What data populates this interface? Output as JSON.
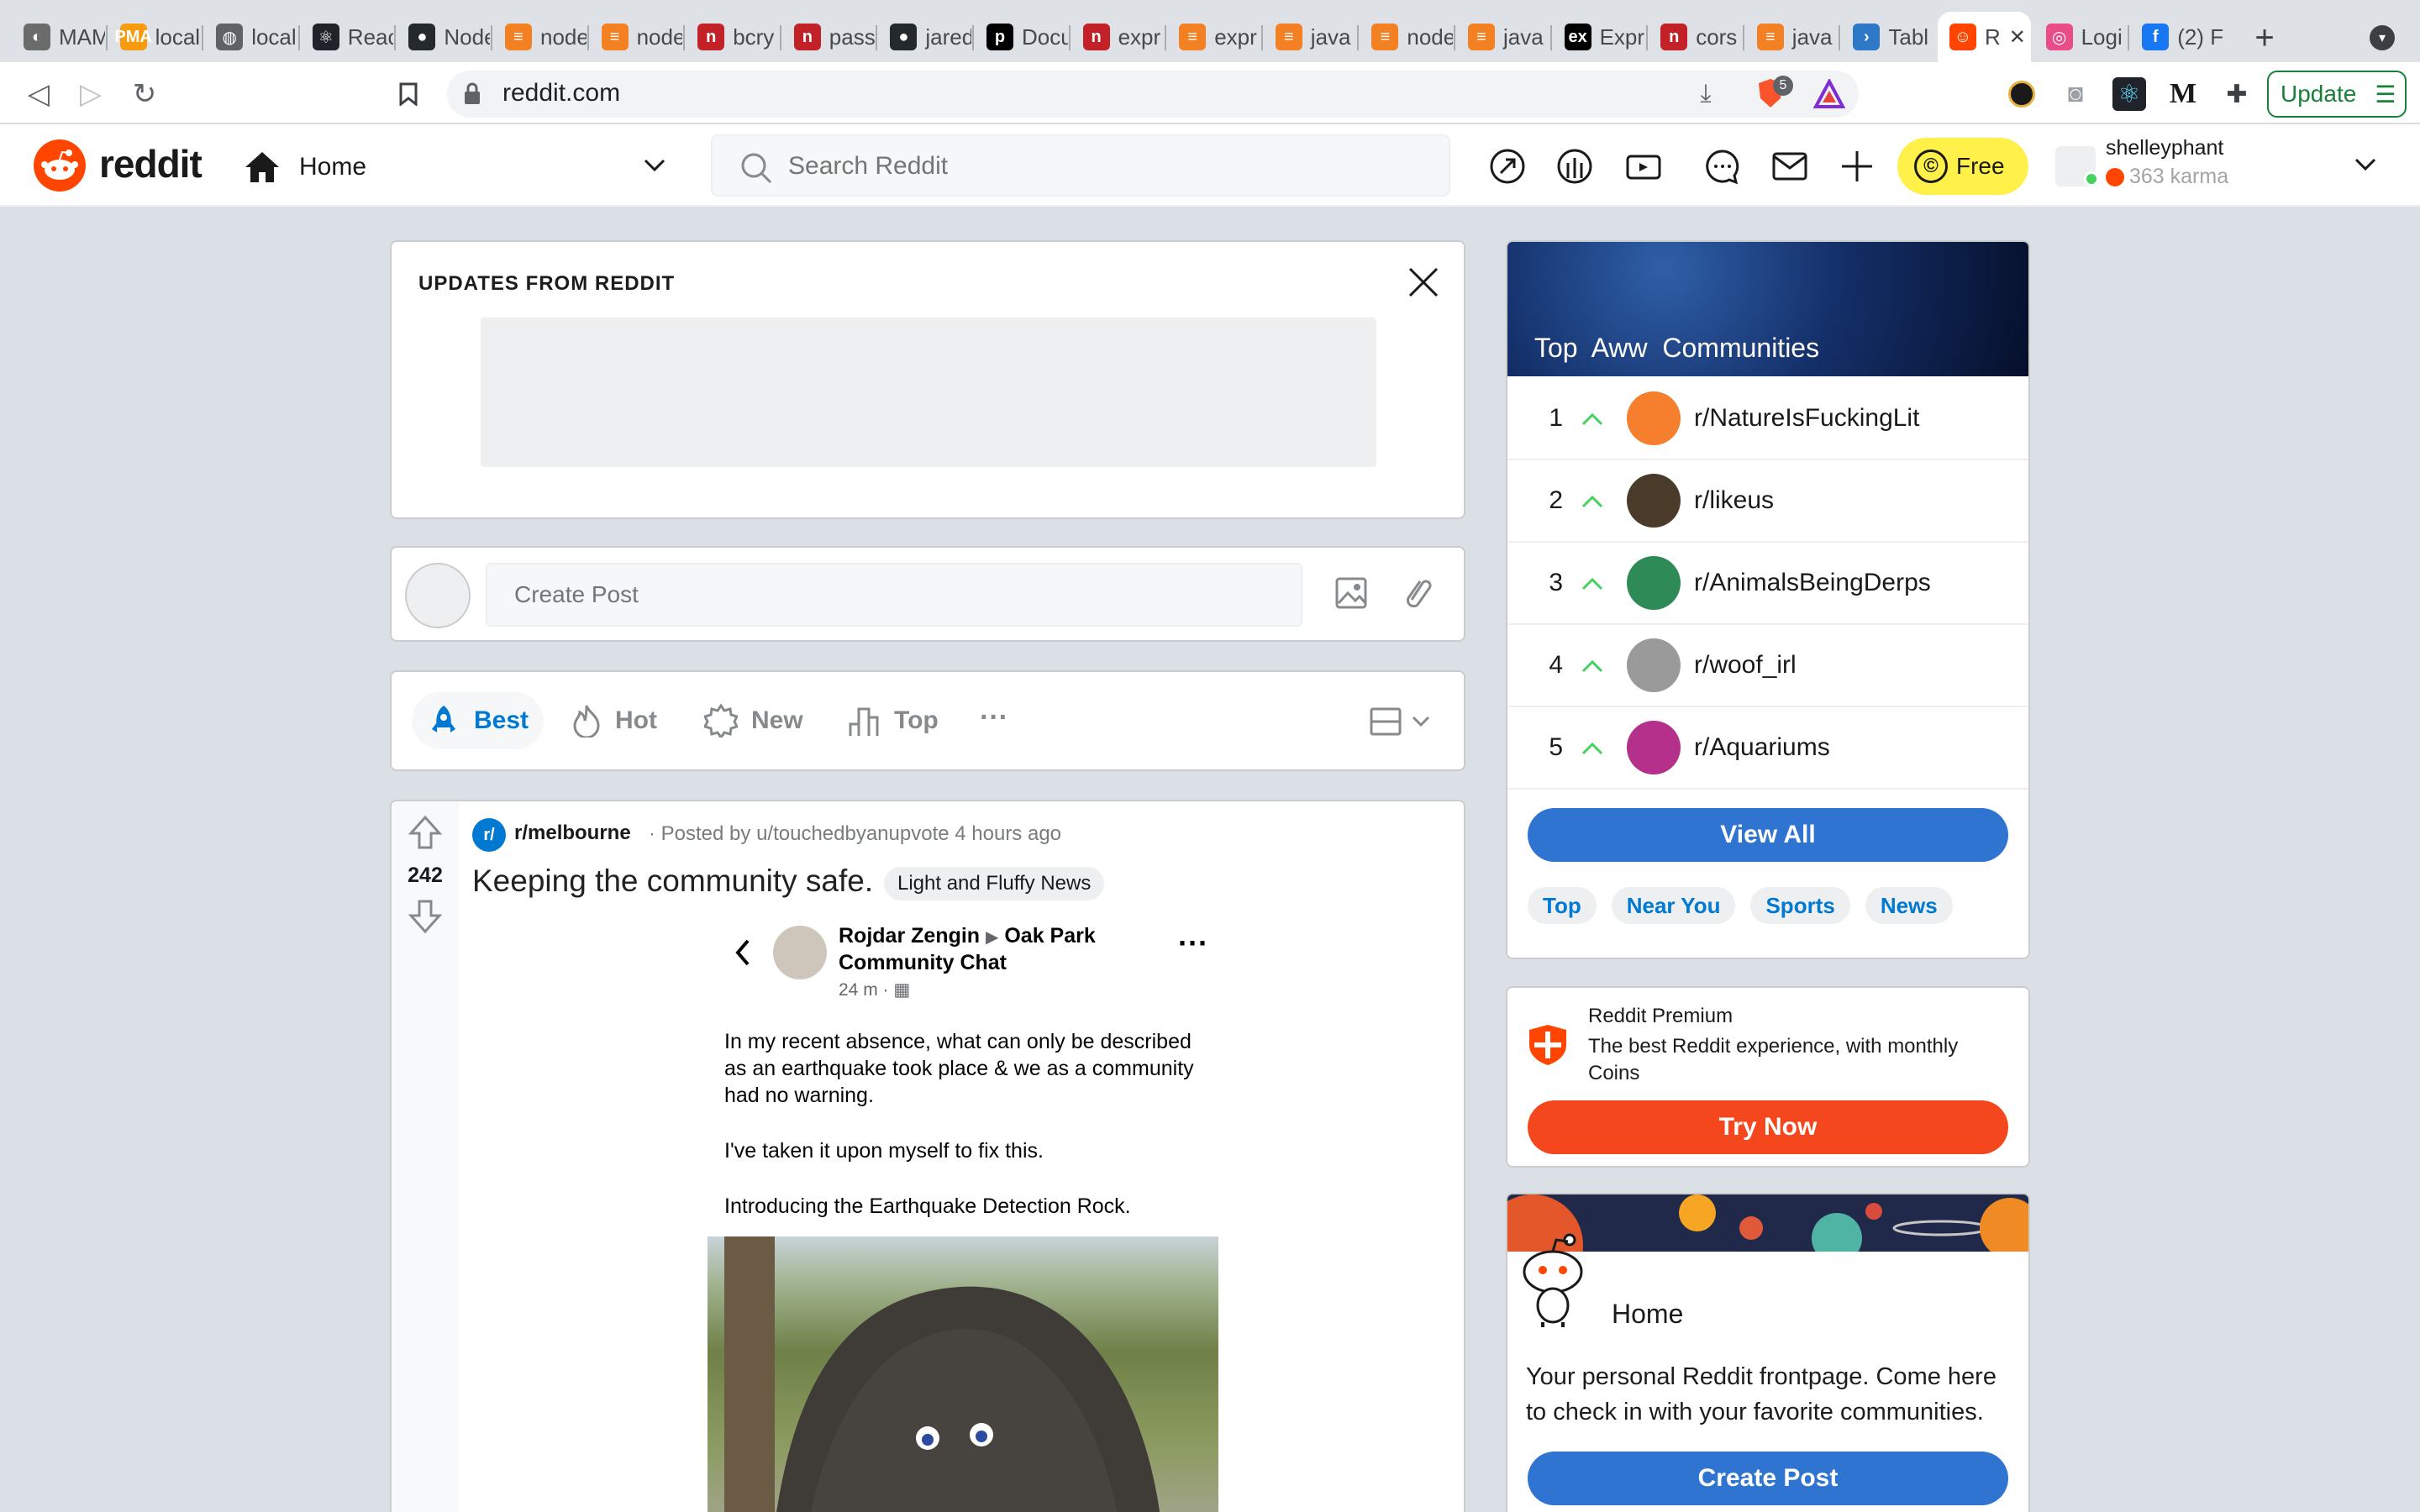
{
  "browser": {
    "tabs": [
      {
        "label": "MAM",
        "color": "#6b6b6b",
        "glyph": "◐"
      },
      {
        "label": "local",
        "color": "#f89c0e",
        "glyph": "PMA"
      },
      {
        "label": "local",
        "color": "#5f6368",
        "glyph": "◍"
      },
      {
        "label": "Reac",
        "color": "#20232a",
        "glyph": "⚛"
      },
      {
        "label": "Node",
        "color": "#24292e",
        "glyph": "●"
      },
      {
        "label": "node",
        "color": "#f48024",
        "glyph": "≡"
      },
      {
        "label": "node",
        "color": "#f48024",
        "glyph": "≡"
      },
      {
        "label": "bcry",
        "color": "#c12127",
        "glyph": "n"
      },
      {
        "label": "pass",
        "color": "#c12127",
        "glyph": "n"
      },
      {
        "label": "jared",
        "color": "#24292e",
        "glyph": "●"
      },
      {
        "label": "Docu",
        "color": "#000000",
        "glyph": "p"
      },
      {
        "label": "expr",
        "color": "#c12127",
        "glyph": "n"
      },
      {
        "label": "expr",
        "color": "#f48024",
        "glyph": "≡"
      },
      {
        "label": "java",
        "color": "#f48024",
        "glyph": "≡"
      },
      {
        "label": "node",
        "color": "#f48024",
        "glyph": "≡"
      },
      {
        "label": "java",
        "color": "#f48024",
        "glyph": "≡"
      },
      {
        "label": "Expr",
        "color": "#000000",
        "glyph": "ex"
      },
      {
        "label": "cors",
        "color": "#c12127",
        "glyph": "n"
      },
      {
        "label": "java",
        "color": "#f48024",
        "glyph": "≡"
      },
      {
        "label": "Tabl",
        "color": "#2d79c7",
        "glyph": "›"
      },
      {
        "label": "R",
        "color": "#ff4500",
        "glyph": "☺",
        "active": true
      },
      {
        "label": "Logi",
        "color": "#ea4c89",
        "glyph": "◎"
      },
      {
        "label": "(2) F",
        "color": "#1877f2",
        "glyph": "f"
      }
    ],
    "url": "reddit.com",
    "update_label": "Update",
    "brave_badge": "5"
  },
  "header": {
    "logo_text": "reddit",
    "home_label": "Home",
    "search_placeholder": "Search Reddit",
    "free_label": "Free",
    "username": "shelleyphant",
    "karma": "363 karma"
  },
  "updates": {
    "title": "UPDATES FROM REDDIT"
  },
  "create_post": {
    "placeholder": "Create Post"
  },
  "sort": {
    "best": "Best",
    "hot": "Hot",
    "new": "New",
    "top": "Top",
    "more": "···"
  },
  "post": {
    "votes": "242",
    "subreddit": "r/melbourne",
    "posted_by": "· Posted by u/touchedbyanupvote 4 hours ago",
    "title": "Keeping the community safe.",
    "flair": "Light and Fluffy News",
    "embed": {
      "author": "Rojdar Zengin",
      "group_line1": "Oak Park",
      "group_line2": "Community Chat",
      "time": "24 m ·",
      "p1": "In my recent absence, what can only be described as an earthquake took place & we as a community had no warning.",
      "p2": "I've taken it upon myself to fix this.",
      "p3": "Introducing the Earthquake Detection Rock."
    }
  },
  "top_communities": {
    "title": "Top  Aww  Communities",
    "items": [
      {
        "rank": "1",
        "name": "r/NatureIsFuckingLit",
        "color": "#f57f2d"
      },
      {
        "rank": "2",
        "name": "r/likeus",
        "color": "#4a3b2b"
      },
      {
        "rank": "3",
        "name": "r/AnimalsBeingDerps",
        "color": "#2e8b57"
      },
      {
        "rank": "4",
        "name": "r/woof_irl",
        "color": "#9a9a9a"
      },
      {
        "rank": "5",
        "name": "r/Aquariums",
        "color": "#b5308a"
      }
    ],
    "view_all": "View All",
    "chips": [
      "Top",
      "Near You",
      "Sports",
      "News"
    ]
  },
  "premium": {
    "title": "Reddit Premium",
    "desc": "The best Reddit experience, with monthly Coins",
    "button": "Try Now"
  },
  "home_card": {
    "title": "Home",
    "desc": "Your personal Reddit frontpage. Come here to check in with your favorite communities.",
    "button": "Create Post"
  },
  "colors": {
    "reddit_orange": "#ff4500",
    "blue": "#0079d3",
    "button_blue": "#2f74d0",
    "premium_orange": "#f5471d",
    "free_yellow": "#fff14a"
  }
}
